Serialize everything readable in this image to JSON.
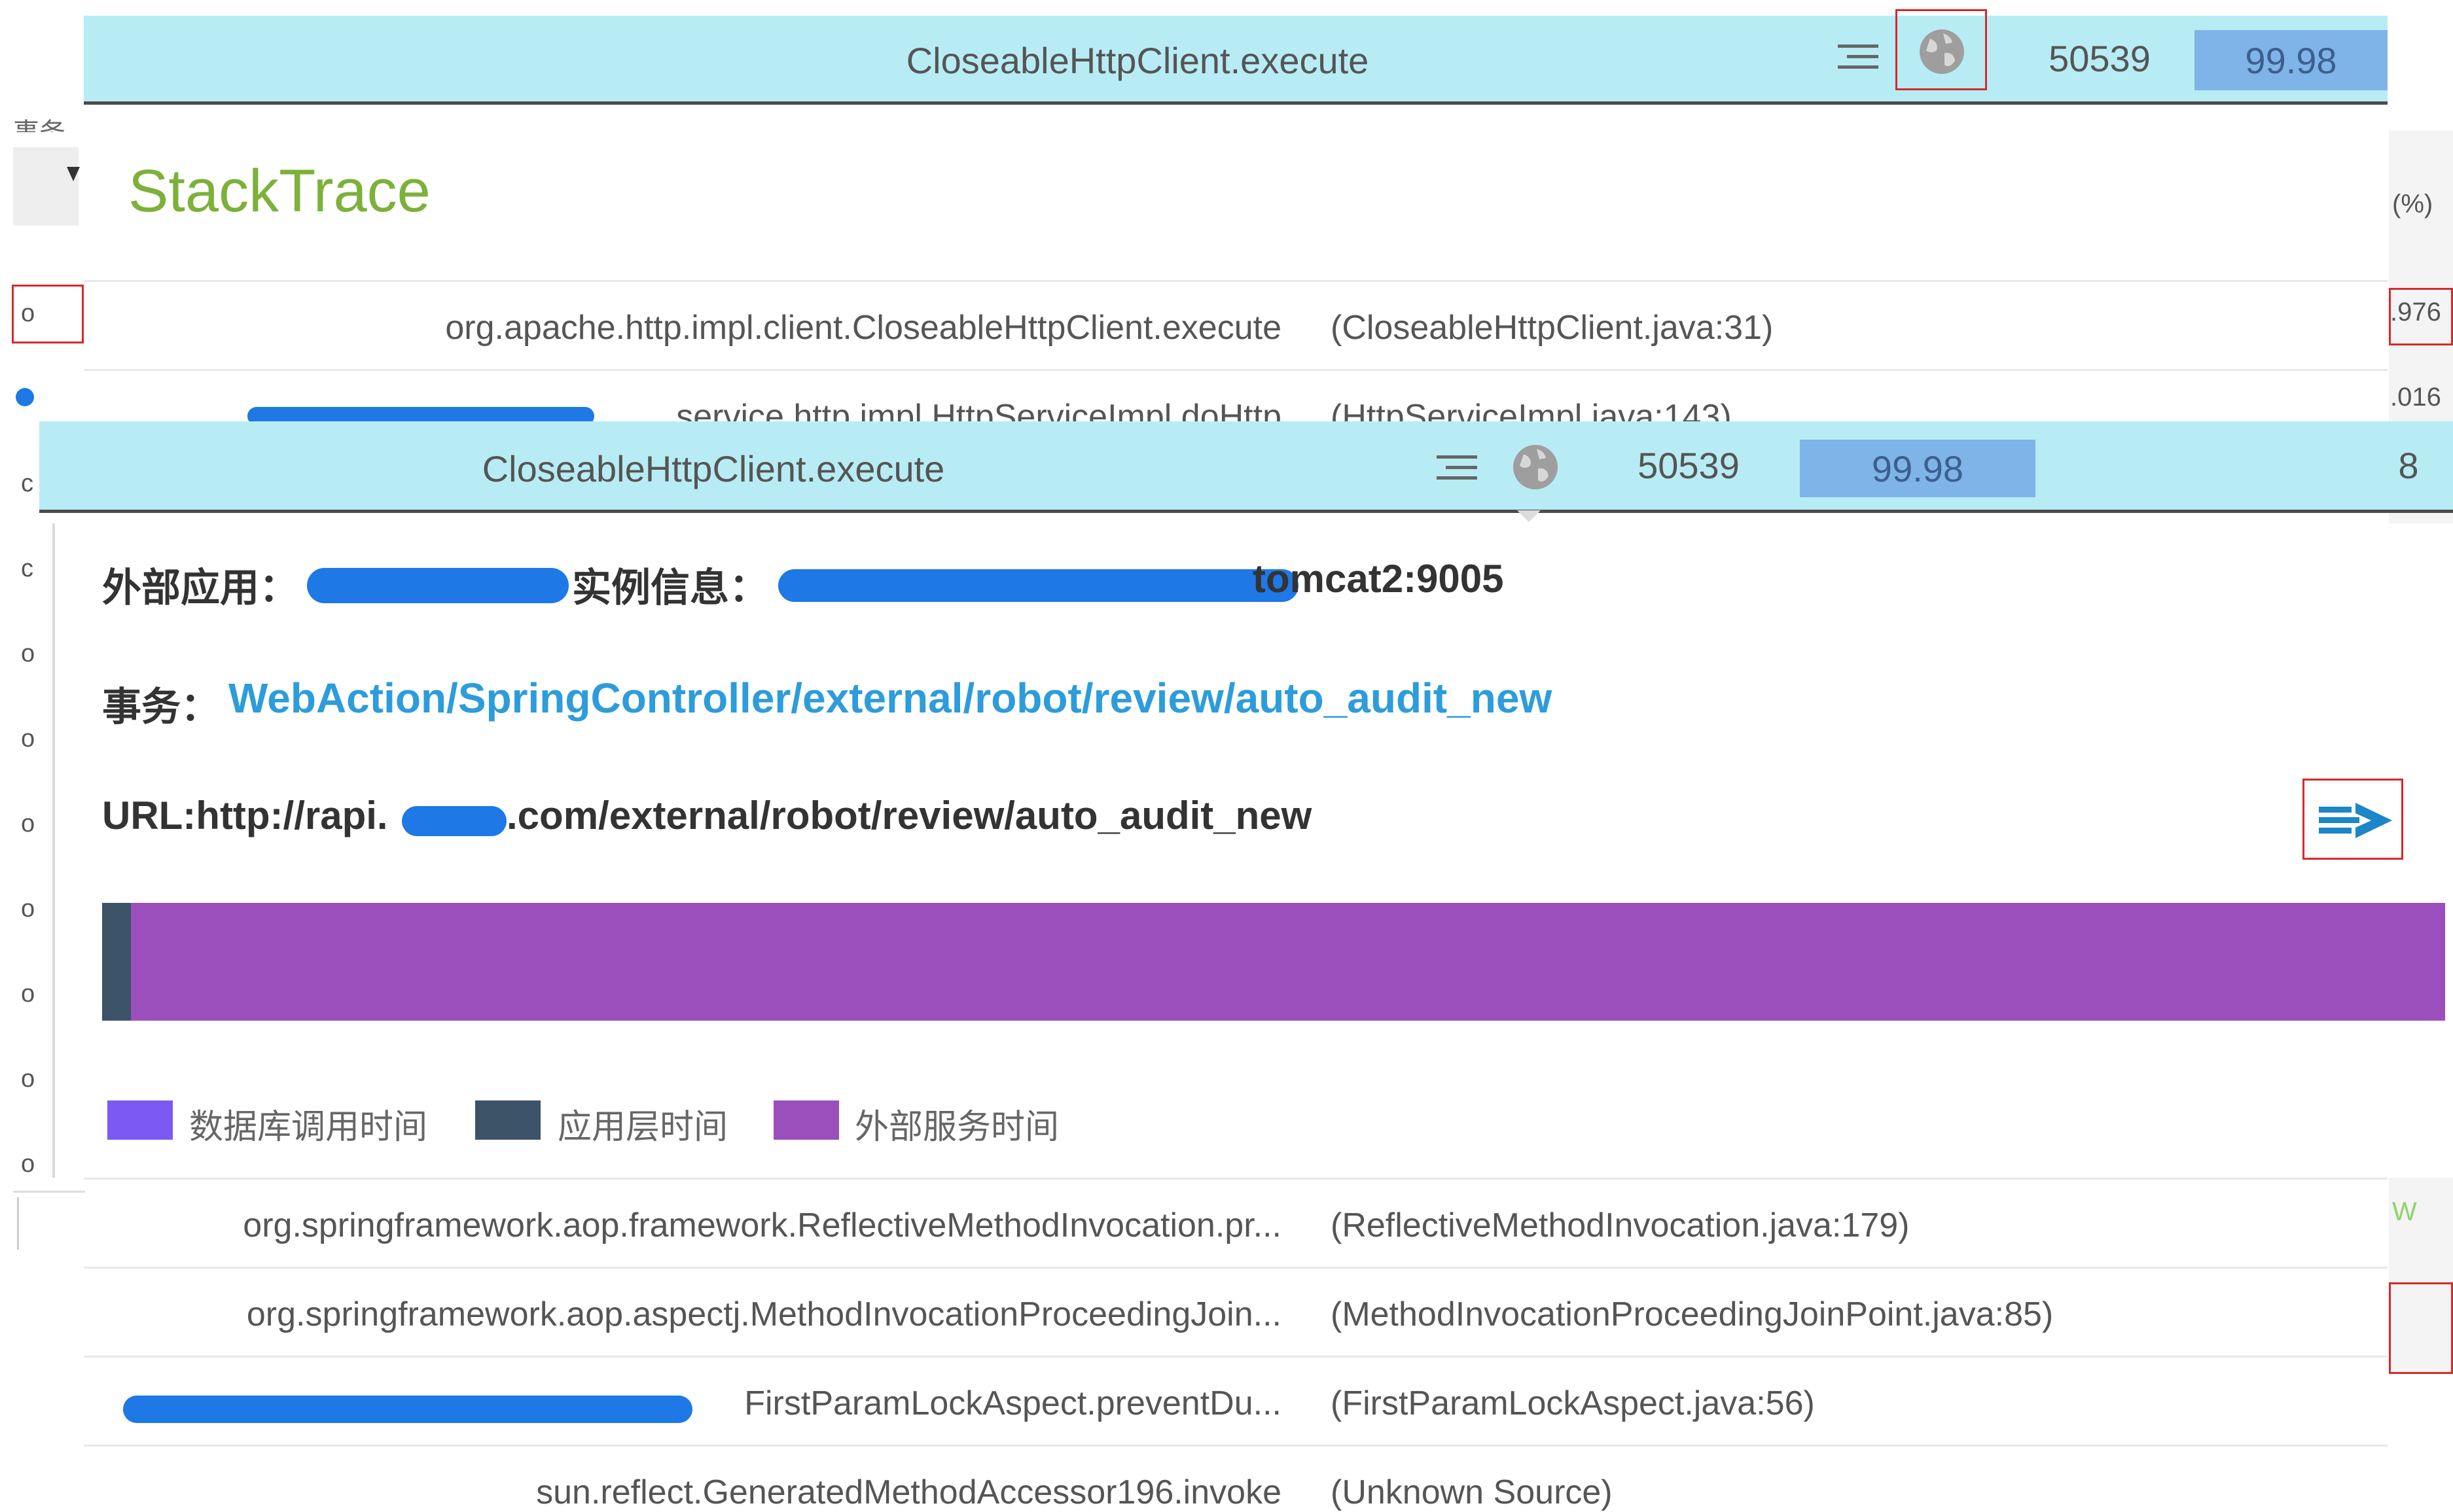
{
  "top_row": {
    "method": "CloseableHttpClient.execute",
    "duration": "50539",
    "percent": "99.98",
    "menu_icon": "menu-lines-icon",
    "globe_icon": "globe-icon"
  },
  "stacktrace": {
    "title": "StackTrace",
    "frames_top": [
      {
        "method": "org.apache.http.impl.client.CloseableHttpClient.execute",
        "source": "(CloseableHttpClient.java:31)"
      },
      {
        "method": "service.http.impl.HttpServiceImpl.doHttp",
        "source": "(HttpServiceImpl.java:143)"
      }
    ],
    "frames_bottom": [
      {
        "method": "org.springframework.aop.framework.ReflectiveMethodInvocation.pr...",
        "source": "(ReflectiveMethodInvocation.java:179)"
      },
      {
        "method": "org.springframework.aop.aspectj.MethodInvocationProceedingJoin...",
        "source": "(MethodInvocationProceedingJoinPoint.java:85)"
      },
      {
        "method": "FirstParamLockAspect.preventDu...",
        "source": "(FirstParamLockAspect.java:56)"
      },
      {
        "method": "sun.reflect.GeneratedMethodAccessor196.invoke",
        "source": "(Unknown Source)"
      }
    ]
  },
  "second_row": {
    "method": "CloseableHttpClient.execute",
    "duration": "50539",
    "percent": "99.98",
    "trailing": "8"
  },
  "detail": {
    "external_app_label": "外部应用：",
    "instance_label": "实例信息：",
    "instance_suffix": "tomcat2:9005",
    "transaction_label": "事务：",
    "transaction_link": "WebAction/SpringController/external/robot/review/auto_audit_new",
    "url_prefix": "URL:http://rapi.",
    "url_suffix": ".com/external/robot/review/auto_audit_new",
    "share_icon": "forward-arrow-icon",
    "timeline_colors": {
      "app": "#3d5368",
      "external": "#9a4fbd",
      "db": "#7c59f2"
    },
    "legend": [
      {
        "label": "数据库调用时间",
        "color": "#7c59f2"
      },
      {
        "label": "应用层时间",
        "color": "#3d5368"
      },
      {
        "label": "外部服务时间",
        "color": "#9a4fbd"
      }
    ]
  },
  "background_left": {
    "header_fragment": "事务",
    "row_marks": [
      "o",
      "o",
      "c",
      "c",
      "o",
      "o",
      "o",
      "o",
      "o",
      "o",
      "o"
    ]
  },
  "background_right": {
    "percent_header": "(%)",
    "values": [
      ".976",
      ".016"
    ],
    "fragment": "W"
  }
}
